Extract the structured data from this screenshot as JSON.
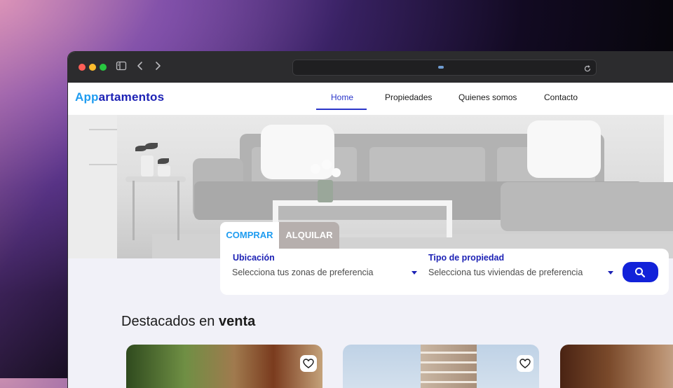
{
  "site": {
    "logo_part1": "App",
    "logo_part2": "artamentos",
    "nav": {
      "home": "Home",
      "propiedades": "Propiedades",
      "quienes": "Quienes somos",
      "contacto": "Contacto"
    }
  },
  "search": {
    "tabs": {
      "comprar": "COMPRAR",
      "alquilar": "ALQUILAR"
    },
    "ubicacion": {
      "label": "Ubicación",
      "placeholder": "Selecciona tus zonas de preferencia"
    },
    "tipo": {
      "label": "Tipo de propiedad",
      "placeholder": "Selecciona tus viviendas de preferencia"
    }
  },
  "featured": {
    "title_prefix": "Destacados en ",
    "title_bold": "venta"
  },
  "colors": {
    "brand_light_blue": "#1f9cf0",
    "brand_dark_blue": "#1d22b5",
    "search_button": "#1222d9"
  },
  "icons": {
    "sidebar": "sidebar-icon",
    "back": "chevron-left-icon",
    "forward": "chevron-right-icon",
    "reload": "reload-icon",
    "search": "search-icon",
    "favorite": "heart-icon",
    "dropdown": "caret-down-icon"
  }
}
